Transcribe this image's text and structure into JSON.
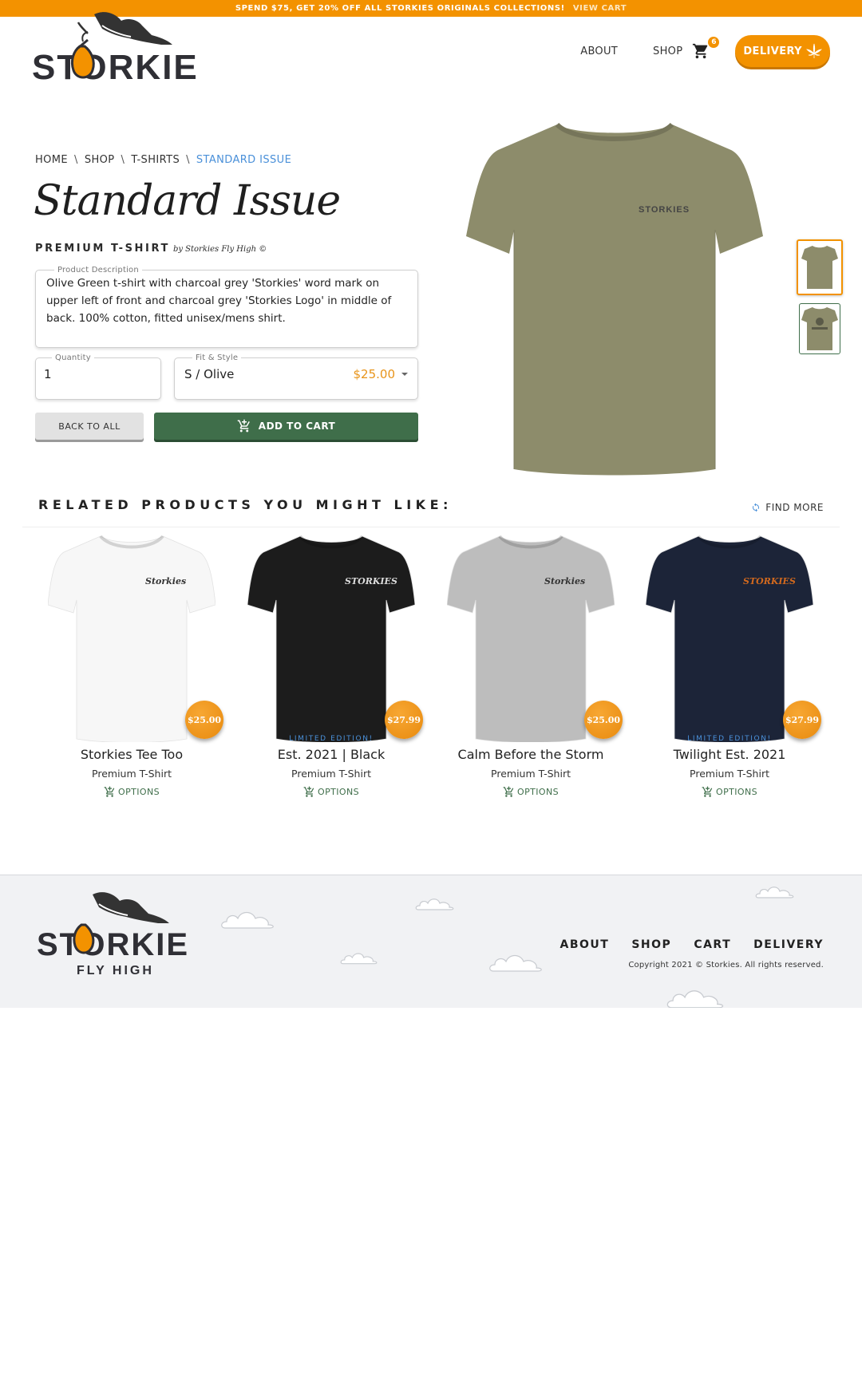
{
  "promo": {
    "text": "SPEND $75, GET 20% OFF ALL STORKIES ORIGINALS COLLECTIONS!",
    "link": "VIEW CART"
  },
  "brand": {
    "logo_text": "STORKIES",
    "footer_tagline": "FLY HIGH"
  },
  "nav": {
    "about": "ABOUT",
    "shop": "SHOP",
    "cart_count": "6",
    "delivery": "DELIVERY"
  },
  "breadcrumb": {
    "home": "HOME",
    "shop": "SHOP",
    "category": "T-SHIRTS",
    "current": "STANDARD ISSUE",
    "separator": "\\"
  },
  "product": {
    "title": "Standard Issue",
    "type": "PREMIUM T-SHIRT",
    "by": "by Storkies Fly High ©",
    "description_label": "Product Description",
    "description": "Olive Green t-shirt with charcoal grey 'Storkies' word mark on upper left of front and charcoal grey 'Storkies Logo' in middle of back. 100% cotton, fitted unisex/mens shirt.",
    "quantity_label": "Quantity",
    "quantity": "1",
    "fit_label": "Fit & Style",
    "fit_value": "S / Olive",
    "price": "$25.00",
    "back_label": "BACK TO ALL",
    "add_label": "ADD TO CART",
    "shirt_print": "STORKIES"
  },
  "related": {
    "title": "RELATED PRODUCTS YOU MIGHT LIKE:",
    "find_more": "FIND MORE",
    "items": [
      {
        "name": "Storkies Tee Too",
        "type": "Premium T-Shirt",
        "price": "$25.00",
        "badge": "",
        "options": "OPTIONS",
        "color": "#f7f7f7",
        "print": "Storkies"
      },
      {
        "name": "Est. 2021 | Black",
        "type": "Premium T-Shirt",
        "price": "$27.99",
        "badge": "LIMITED EDITION!",
        "options": "OPTIONS",
        "color": "#1c1c1c",
        "print": "STORKIES"
      },
      {
        "name": "Calm Before the Storm",
        "type": "Premium T-Shirt",
        "price": "$25.00",
        "badge": "",
        "options": "OPTIONS",
        "color": "#bdbdbd",
        "print": "Storkies"
      },
      {
        "name": "Twilight Est. 2021",
        "type": "Premium T-Shirt",
        "price": "$27.99",
        "badge": "LIMITED EDITION!",
        "options": "OPTIONS",
        "color": "#1c2438",
        "print": "STORKIES"
      }
    ]
  },
  "footer": {
    "links": [
      "ABOUT",
      "SHOP",
      "CART",
      "DELIVERY"
    ],
    "copyright": "Copyright 2021 © Storkies. All rights reserved."
  },
  "colors": {
    "accent": "#f39200",
    "green": "#3f6e4a",
    "link_blue": "#4a90d9",
    "olive": "#8d8c6b"
  }
}
